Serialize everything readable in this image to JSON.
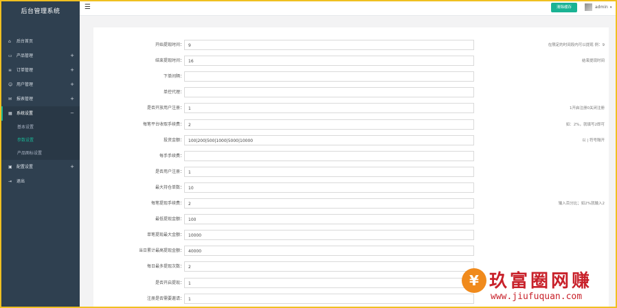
{
  "app": {
    "title": "后台管理系统"
  },
  "topbar": {
    "clear_label": "清除缓存",
    "user": "admin"
  },
  "sidebar": {
    "items": [
      {
        "label": "后台首页",
        "icon": "home-icon",
        "glyph": "⌂",
        "expandable": false
      },
      {
        "label": "产品管理",
        "icon": "monitor-icon",
        "glyph": "▭",
        "expandable": true
      },
      {
        "label": "订单管理",
        "icon": "list-icon",
        "glyph": "≡",
        "expandable": true
      },
      {
        "label": "用户管理",
        "icon": "users-icon",
        "glyph": "☺",
        "expandable": true
      },
      {
        "label": "报表管理",
        "icon": "mail-icon",
        "glyph": "✉",
        "expandable": true
      },
      {
        "label": "系统设置",
        "icon": "table-icon",
        "glyph": "▦",
        "expandable": true,
        "open": true
      },
      {
        "label": "配置设置",
        "icon": "image-icon",
        "glyph": "▣",
        "expandable": true
      },
      {
        "label": "退出",
        "icon": "logout-icon",
        "glyph": "⇥",
        "expandable": false
      }
    ],
    "sub_items": [
      {
        "label": "基本设置",
        "active": false
      },
      {
        "label": "参数设置",
        "active": true
      },
      {
        "label": "产品图标设置",
        "active": false
      }
    ]
  },
  "form": {
    "rows": [
      {
        "label": "开始提现时间：",
        "value": "9",
        "hint": "在限定的时间段内可以提现 例：9"
      },
      {
        "label": "结束提现时间：",
        "value": "16",
        "hint": "结束提现时间"
      },
      {
        "label": "下单间隔：",
        "value": "",
        "hint": ""
      },
      {
        "label": "单控代理：",
        "value": "",
        "hint": ""
      },
      {
        "label": "是否开放用户注册：",
        "value": "1",
        "hint": "1开启注册0关闭注册"
      },
      {
        "label": "每笔平台收取手续费：",
        "value": "2",
        "hint": "如：2%，就填写2即可"
      },
      {
        "label": "投资金额：",
        "value": "100|200|500|1000|5000|10000",
        "hint": "以 | 符号隔开"
      },
      {
        "label": "每手手续费：",
        "value": "",
        "hint": ""
      },
      {
        "label": "是否用户注册：",
        "value": "1",
        "hint": ""
      },
      {
        "label": "最大持仓单数：",
        "value": "10",
        "hint": ""
      },
      {
        "label": "每笔提现手续费：",
        "value": "2",
        "hint": "输入百分比；如2%就输入2"
      },
      {
        "label": "最低提现金额：",
        "value": "100",
        "hint": ""
      },
      {
        "label": "单笔提现最大金额：",
        "value": "10000",
        "hint": ""
      },
      {
        "label": "当日累计最高提现金额：",
        "value": "40000",
        "hint": ""
      },
      {
        "label": "每日最多提现次数：",
        "value": "2",
        "hint": ""
      },
      {
        "label": "是否开启提现：",
        "value": "1",
        "hint": ""
      },
      {
        "label": "注册是否需要邀请：",
        "value": "1",
        "hint": ""
      }
    ]
  },
  "watermark": {
    "title": "玖富圈网赚",
    "url": "www.jiufuquan.com",
    "logo_glyph": "¥"
  },
  "colors": {
    "sidebar": "#2f4050",
    "accent": "#1ab394",
    "frame": "#f0c020",
    "watermark": "#c8212a"
  }
}
